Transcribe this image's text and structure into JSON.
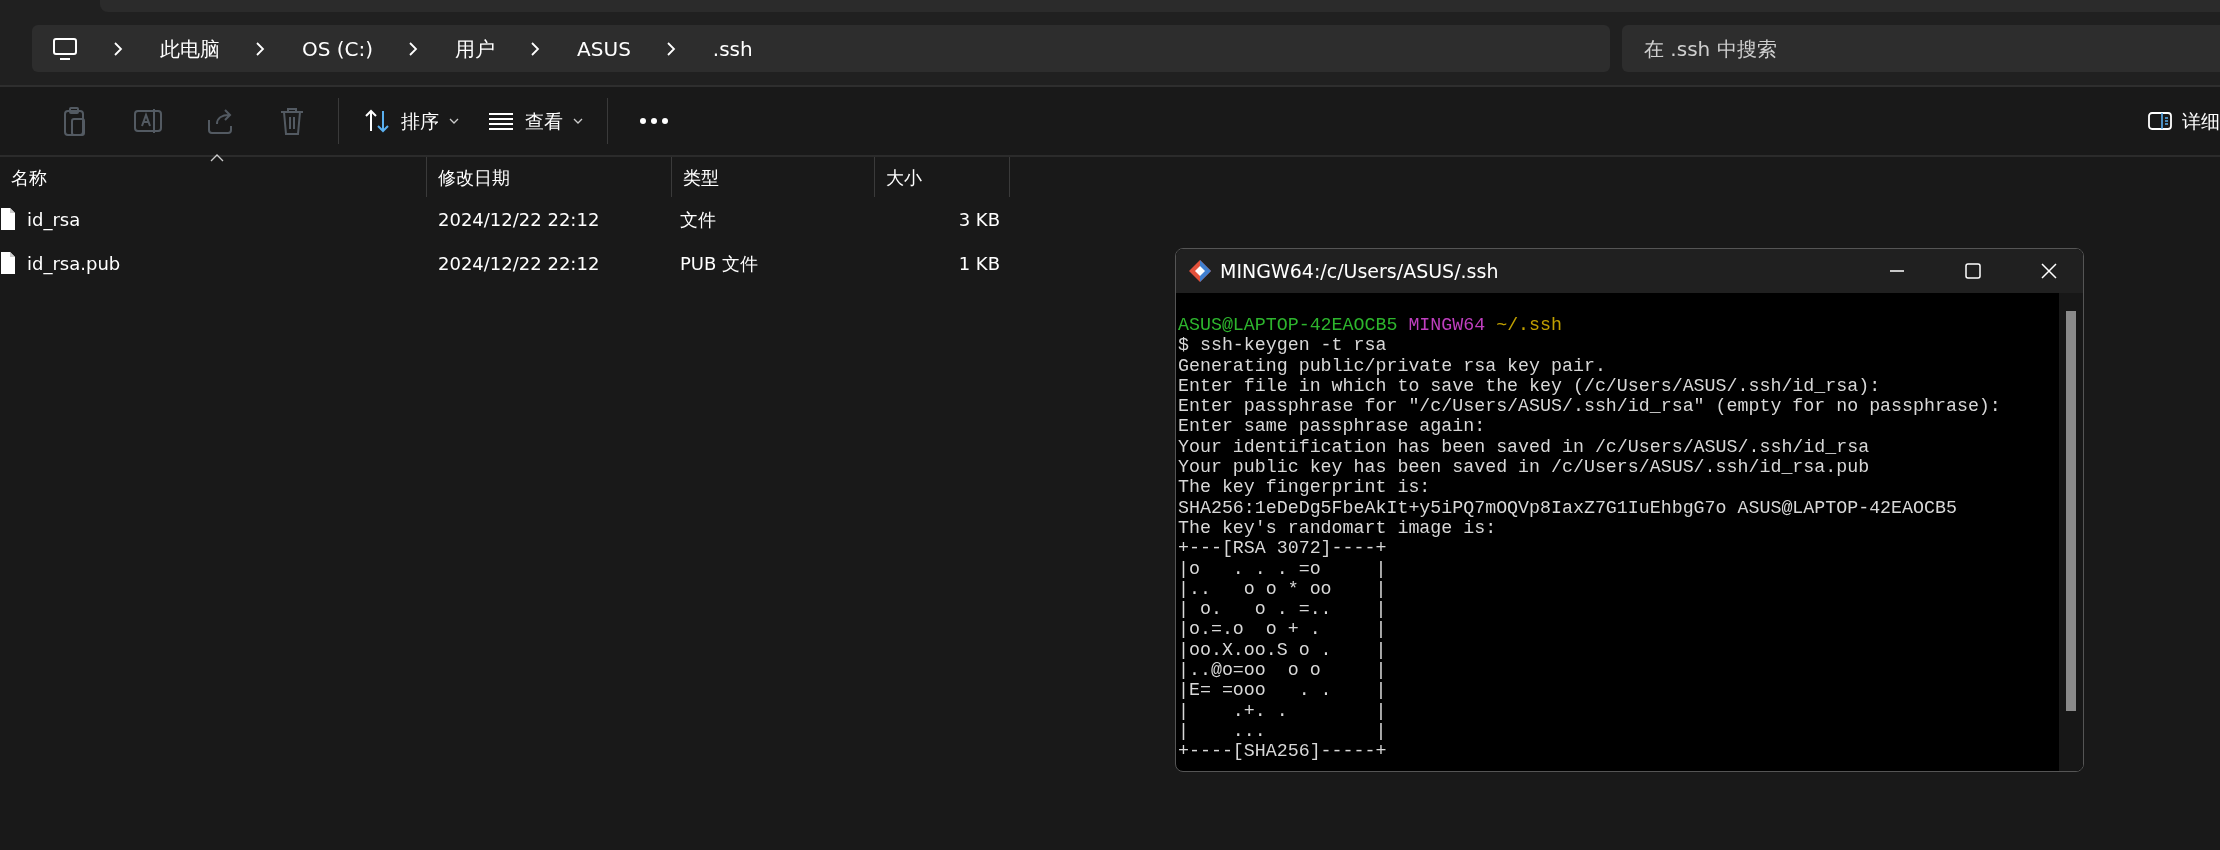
{
  "address_bar": {
    "breadcrumbs": [
      "此电脑",
      "OS (C:)",
      "用户",
      "ASUS",
      ".ssh"
    ],
    "search": {
      "placeholder": "在 .ssh 中搜索"
    }
  },
  "toolbar": {
    "icon_buttons": [
      {
        "kind": "clipboard",
        "disabled": true
      },
      {
        "kind": "rename",
        "disabled": true
      },
      {
        "kind": "share",
        "disabled": true
      },
      {
        "kind": "delete",
        "disabled": true
      }
    ],
    "menus": [
      {
        "kind": "sort",
        "label": "排序"
      },
      {
        "kind": "view",
        "label": "查看"
      }
    ],
    "details": {
      "label": "详细"
    }
  },
  "file_list": {
    "columns": [
      "名称",
      "修改日期",
      "类型",
      "大小"
    ],
    "rows": [
      {
        "name": "id_rsa",
        "modified": "2024/12/22 22:12",
        "type": "文件",
        "size": "3 KB"
      },
      {
        "name": "id_rsa.pub",
        "modified": "2024/12/22 22:12",
        "type": "PUB 文件",
        "size": "1 KB"
      }
    ]
  },
  "terminal": {
    "title": "MINGW64:/c/Users/ASUS/.ssh",
    "lines": [
      [
        {
          "text": "ASUS@LAPTOP-42EAOCB5",
          "color": "#2db52d"
        },
        {
          "text": "MINGW64",
          "color": "#bf3fbf"
        },
        {
          "text": "~/.ssh",
          "color": "#c0a000"
        }
      ],
      [
        {
          "text": "$ ssh-keygen -t rsa"
        }
      ],
      [
        {
          "text": "Generating public/private rsa key pair."
        }
      ],
      [
        {
          "text": "Enter file in which to save the key (/c/Users/ASUS/.ssh/id_rsa):"
        }
      ],
      [
        {
          "text": "Enter passphrase for \"/c/Users/ASUS/.ssh/id_rsa\" (empty for no passphrase):"
        }
      ],
      [
        {
          "text": "Enter same passphrase again:"
        }
      ],
      [
        {
          "text": "Your identification has been saved in /c/Users/ASUS/.ssh/id_rsa"
        }
      ],
      [
        {
          "text": "Your public key has been saved in /c/Users/ASUS/.ssh/id_rsa.pub"
        }
      ],
      [
        {
          "text": "The key fingerprint is:"
        }
      ],
      [
        {
          "text": "SHA256:1eDeDg5FbeAkIt+y5iPQ7mOQVp8IaxZ7G1IuEhbgG7o ASUS@LAPTOP-42EAOCB5"
        }
      ],
      [
        {
          "text": "The key's randomart image is:"
        }
      ],
      [
        {
          "text": "+---[RSA 3072]----+"
        }
      ],
      [
        {
          "text": "|o   . . . =o     |"
        }
      ],
      [
        {
          "text": "|..   o o * oo    |"
        }
      ],
      [
        {
          "text": "| o.   o . =..    |"
        }
      ],
      [
        {
          "text": "|o.=.o  o + .     |"
        }
      ],
      [
        {
          "text": "|oo.X.oo.S o .    |"
        }
      ],
      [
        {
          "text": "|..@o=oo  o o     |"
        }
      ],
      [
        {
          "text": "|E= =ooo   . .    |"
        }
      ],
      [
        {
          "text": "|    .+. .        |"
        }
      ],
      [
        {
          "text": "|    ...          |"
        }
      ],
      [
        {
          "text": "+----[SHA256]-----+"
        }
      ]
    ]
  }
}
